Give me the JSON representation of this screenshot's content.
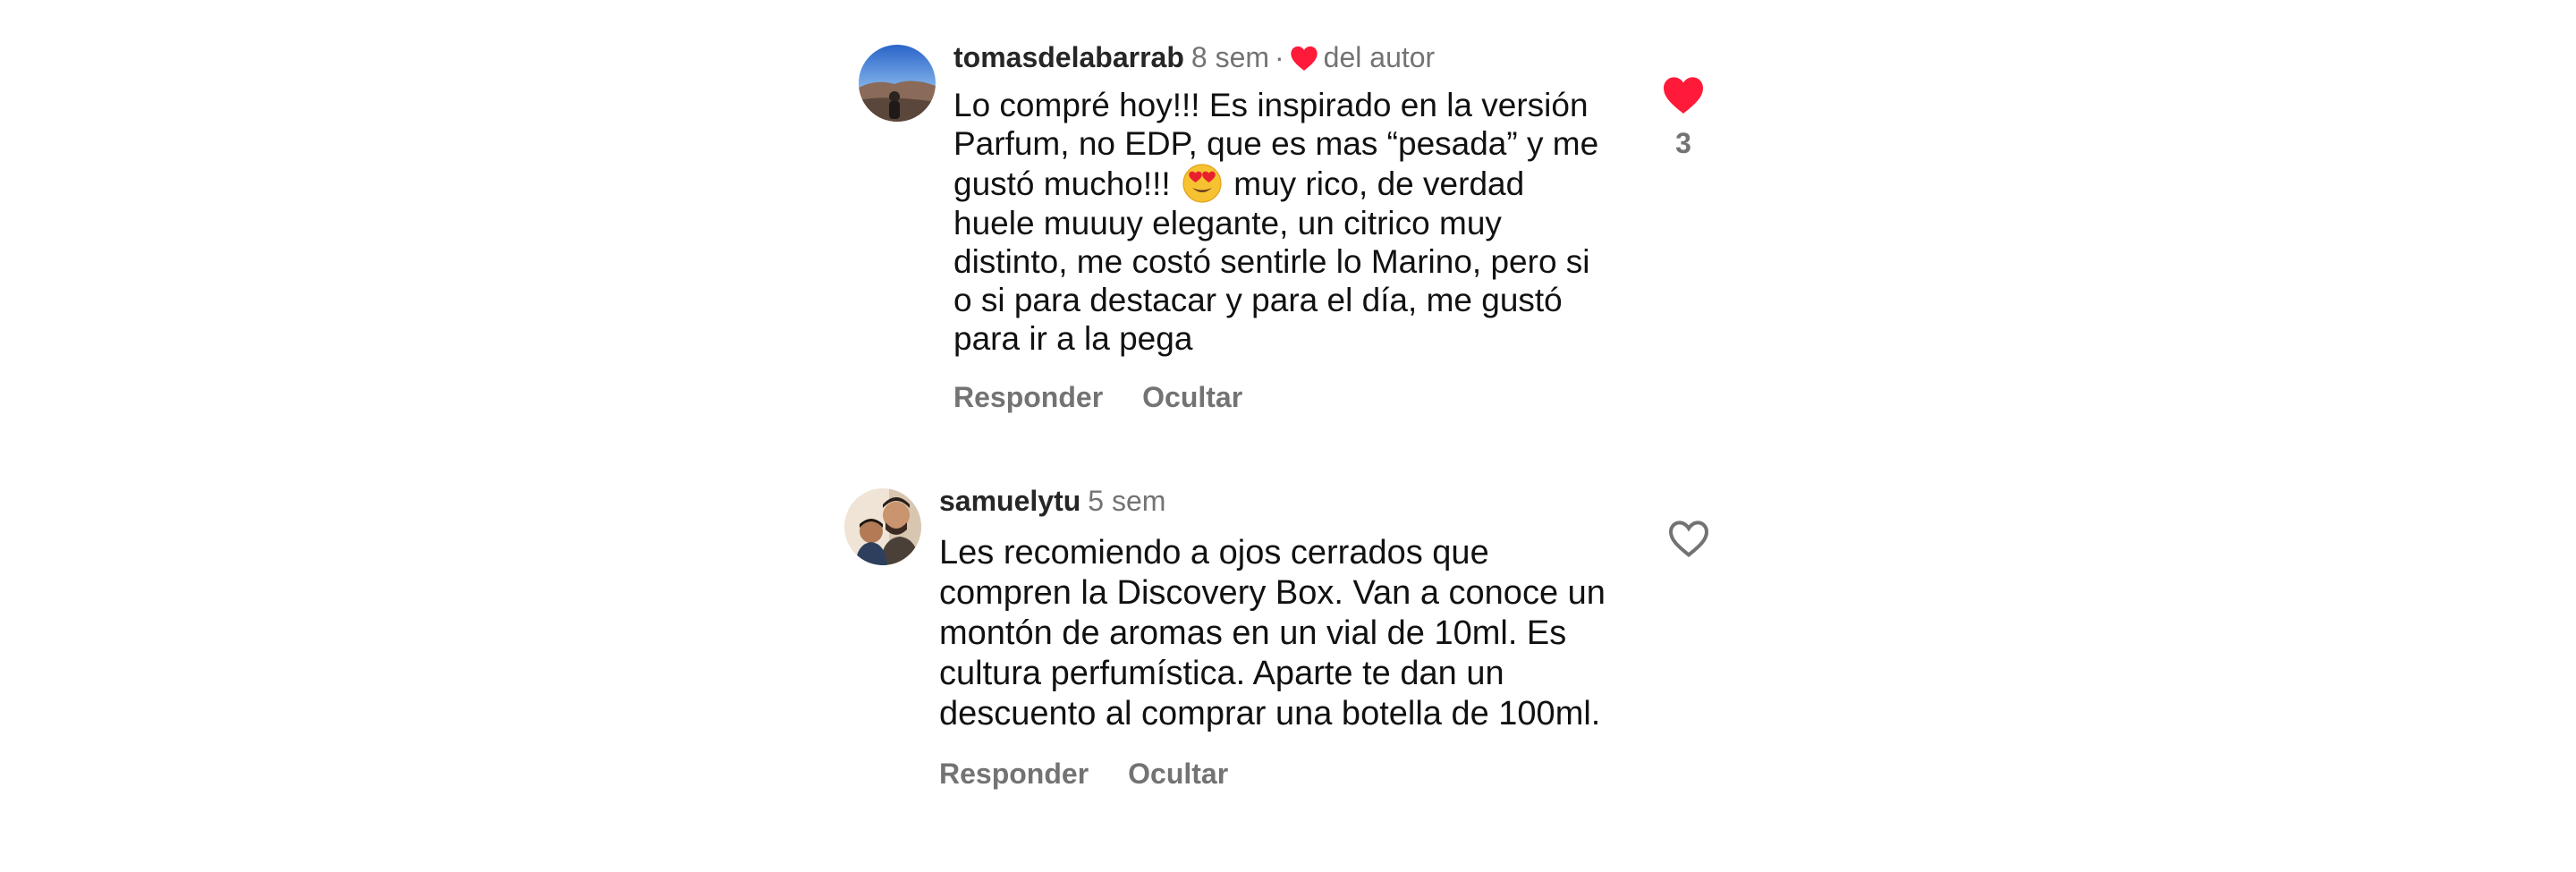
{
  "comments": [
    {
      "username": "tomasdelabarrab",
      "time": "8 sem",
      "separator": "·",
      "author_label": "del autor",
      "text_before_emoji": "Lo compré hoy!!! Es inspirado en la versión\nParfum, no EDP, que es mas “pesada” y me\ngustó mucho!!!",
      "emoji": "heart-eyes-emoji",
      "text_after_emoji": "muy rico, de verdad\nhuele muuuy elegante, un citrico muy\ndistinto, me costó sentirle lo Marino, pero si\no si para destacar y para el día, me gustó\npara ir a la pega",
      "reply_label": "Responder",
      "hide_label": "Ocultar",
      "liked": true,
      "like_count": "3",
      "avatar_icon": "profile-photo"
    },
    {
      "username": "samuelytu",
      "time": "5 sem",
      "text": "Les recomiendo a ojos cerrados que\ncompren la Discovery Box. Van a conoce un\nmontón de aromas en un vial de 10ml. Es\ncultura perfumística. Aparte te dan un\ndescuento al comprar una botella de 100ml.",
      "reply_label": "Responder",
      "hide_label": "Ocultar",
      "liked": false,
      "avatar_icon": "profile-photo"
    }
  ],
  "colors": {
    "like_red": "#ff3040",
    "meta_gray": "#737373",
    "text": "#111111"
  }
}
